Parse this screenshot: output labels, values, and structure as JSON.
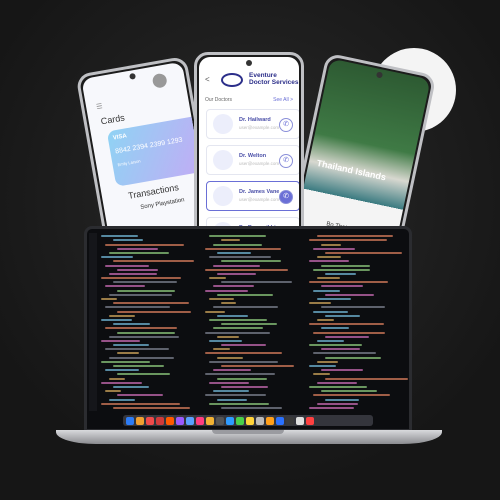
{
  "wallet_app": {
    "section_cards": "Cards",
    "card_brand": "VISA",
    "card_number": "8842 2394 2399 1293",
    "card_holder": "Emily Larson",
    "section_transactions": "Transactions",
    "transaction": "Sony Playstation"
  },
  "doctor_app": {
    "back": "<",
    "title_line1": "Eventure",
    "title_line2": "Doctor Services",
    "section": "Our Doctors",
    "see_all": "See All >",
    "doctors": [
      {
        "name": "Dr. Hailward",
        "email": "user@example.com",
        "selected": false
      },
      {
        "name": "Dr. Welton",
        "email": "user@example.com",
        "selected": false
      },
      {
        "name": "Dr. James Vane",
        "email": "user@example.com",
        "selected": true
      },
      {
        "name": "Dr. Raxumikhin",
        "email": "user@example.com",
        "selected": false
      }
    ],
    "accent": "#6a6fd6"
  },
  "travel_app": {
    "title": "Thailand Islands",
    "subtitle": "Bo Thai"
  },
  "laptop": {
    "dock_colors": [
      "#2d7cf6",
      "#f0a030",
      "#ef4a4a",
      "#d03a3a",
      "#ff5a00",
      "#9b59ff",
      "#5aa0ff",
      "#ff3d7f",
      "#f2b233",
      "#555",
      "#2e9bff",
      "#4ad04a",
      "#ffd33a",
      "#bbb",
      "#ff9f1a",
      "#2a71ff",
      "#3a3a3a",
      "#e0e0e0",
      "#ff4040"
    ]
  }
}
